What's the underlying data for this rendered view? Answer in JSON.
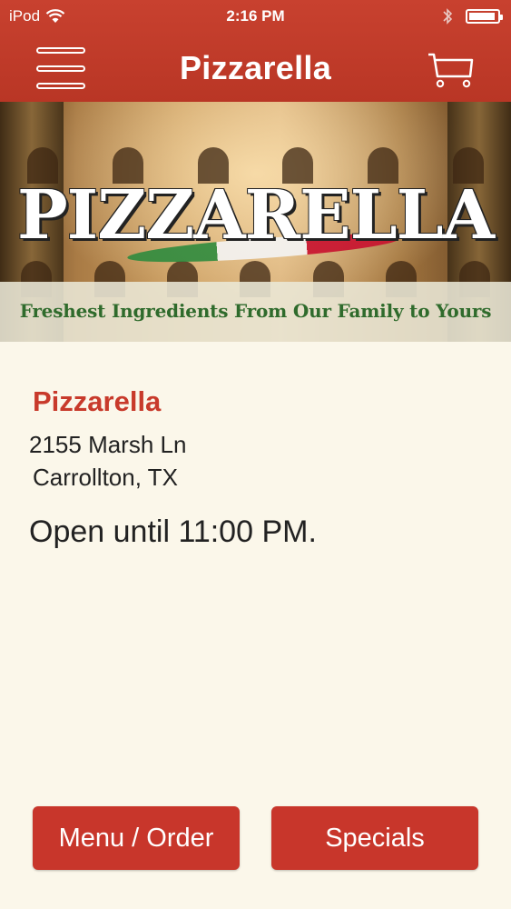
{
  "status_bar": {
    "carrier": "iPod",
    "time": "2:16 PM",
    "icons": [
      "wifi-icon",
      "bluetooth-icon",
      "battery-icon"
    ]
  },
  "nav": {
    "title": "Pizzarella",
    "menu_icon": "hamburger-menu-icon",
    "cart_icon": "shopping-cart-icon"
  },
  "banner": {
    "logo_text": "PIZZARELLA",
    "tagline": "Freshest Ingredients From Our Family to Yours"
  },
  "store": {
    "name": "Pizzarella",
    "address_line1": "2155 Marsh Ln",
    "address_line2": "Carrollton, TX",
    "hours": "Open until 11:00 PM."
  },
  "actions": {
    "menu_order_label": "Menu / Order",
    "specials_label": "Specials"
  },
  "colors": {
    "brand_red": "#c8362b",
    "background": "#fbf7ea",
    "tagline_green": "#2f6b2c"
  }
}
